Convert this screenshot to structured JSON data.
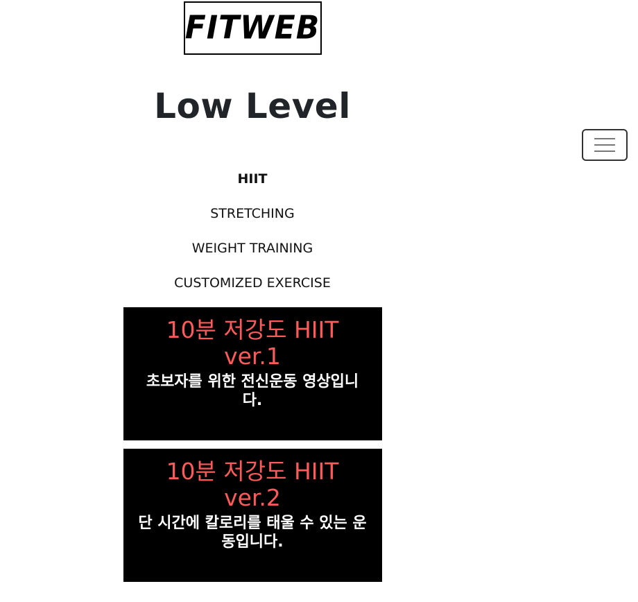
{
  "brand": {
    "logo_text": "FITWEB"
  },
  "page": {
    "title": "Low Level"
  },
  "nav": {
    "items": [
      {
        "label": "HIIT",
        "active": true
      },
      {
        "label": "STRETCHING",
        "active": false
      },
      {
        "label": "WEIGHT TRAINING",
        "active": false
      },
      {
        "label": "CUSTOMIZED EXERCISE",
        "active": false
      }
    ]
  },
  "cards": [
    {
      "title": "10분 저강도 HIIT ver.1",
      "description": "초보자를 위한 전신운동 영상입니다."
    },
    {
      "title": "10분 저강도 HIIT ver.2",
      "description": "단 시간에 칼로리를 태울 수 있는 운동입니다."
    }
  ],
  "toggler": {
    "icon": "hamburger-menu-icon"
  },
  "colors": {
    "card_background": "#000000",
    "card_title": "#ff5a5a",
    "card_text": "#ffffff",
    "heading": "#212529"
  }
}
